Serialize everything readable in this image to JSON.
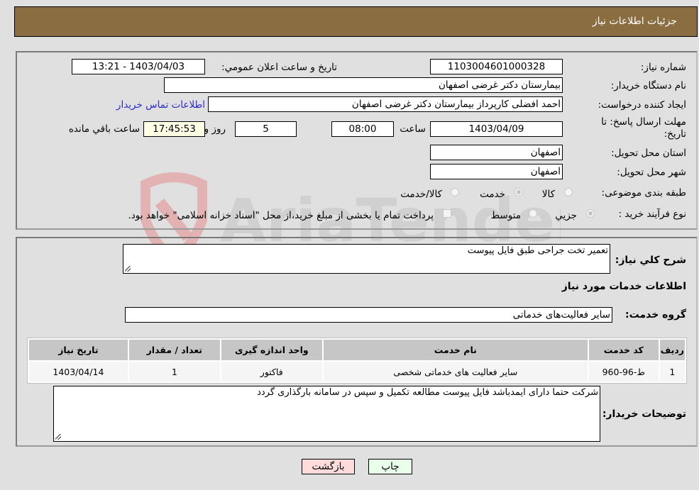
{
  "header": {
    "title": "جزئیات اطلاعات نیاز"
  },
  "details": {
    "need_number_label": "شماره نیاز:",
    "need_number": "1103004601000328",
    "announce_label": "تاریخ و ساعت اعلان عمومي:",
    "announce_value": "1403/04/03 - 13:21",
    "buyer_org_label": "نام دستگاه خریدار:",
    "buyer_org": "بیمارستان دکتر غرضی اصفهان",
    "creator_label": "ایجاد کننده درخواست:",
    "creator": "احمد افضلی کارپرداز بیمارستان دکتر غرضی اصفهان",
    "contact_link": "اطلاعات تماس خریدار",
    "deadline_label_line1": "مهلت ارسال پاسخ: تا",
    "deadline_label_line2": "تاریخ:",
    "deadline_date": "1403/04/09",
    "time_label": "ساعت",
    "deadline_time": "08:00",
    "days_value": "5",
    "days_label": "روز و",
    "remaining_time": "17:45:53",
    "remaining_label": "ساعت باقي مانده",
    "province_label": "استان محل تحویل:",
    "province": "اصفهان",
    "city_label": "شهر محل تحویل:",
    "city": "اصفهان",
    "category_label": "طبقه بندی موضوعی:",
    "category_options": [
      {
        "label": "کالا",
        "selected": false
      },
      {
        "label": "خدمت",
        "selected": true
      },
      {
        "label": "کالا/خدمت",
        "selected": false
      }
    ],
    "purchase_type_label": "نوع فرآیند خرید :",
    "purchase_type_options": [
      {
        "label": "جزيي",
        "selected": true
      },
      {
        "label": "متوسط",
        "selected": false
      }
    ],
    "treasury_note": "پرداخت تمام یا بخشی از مبلغ خرید،از محل \"اسناد خزانه اسلامی\" خواهد بود.",
    "treasury_checked": false
  },
  "summary": {
    "description_label": "شرح کلي نیاز:",
    "description": "تعمیر تخت جراحی طبق فایل پیوست",
    "services_heading": "اطلاعات خدمات مورد نیاز",
    "service_group_label": "گروه خدمت:",
    "service_group": "سایر فعالیت‌های خدماتی",
    "table": {
      "headers": [
        "ردیف",
        "کد خدمت",
        "نام خدمت",
        "واحد اندازه گیری",
        "تعداد / مقدار",
        "تاریخ نیاز"
      ],
      "rows": [
        [
          "1",
          "ط-96-960",
          "سایر فعالیت های خدماتی شخصی",
          "فاکتور",
          "1",
          "1403/04/14"
        ]
      ]
    },
    "buyer_notes_label": "توضیحات خریدار:",
    "buyer_notes": "شرکت حتما دارای ایمدباشد  فایل پیوست مطالعه تکمیل و سپس در سامانه بارگذاری گردد"
  },
  "buttons": {
    "print": "چاپ",
    "back": "بازگشت"
  },
  "colors": {
    "header_bg": "#8b6d42",
    "print_bg": "#eaffea",
    "back_bg": "#ffdcdc",
    "link": "#2a2acb"
  },
  "watermark": {
    "text": "AriaTender.neT"
  }
}
